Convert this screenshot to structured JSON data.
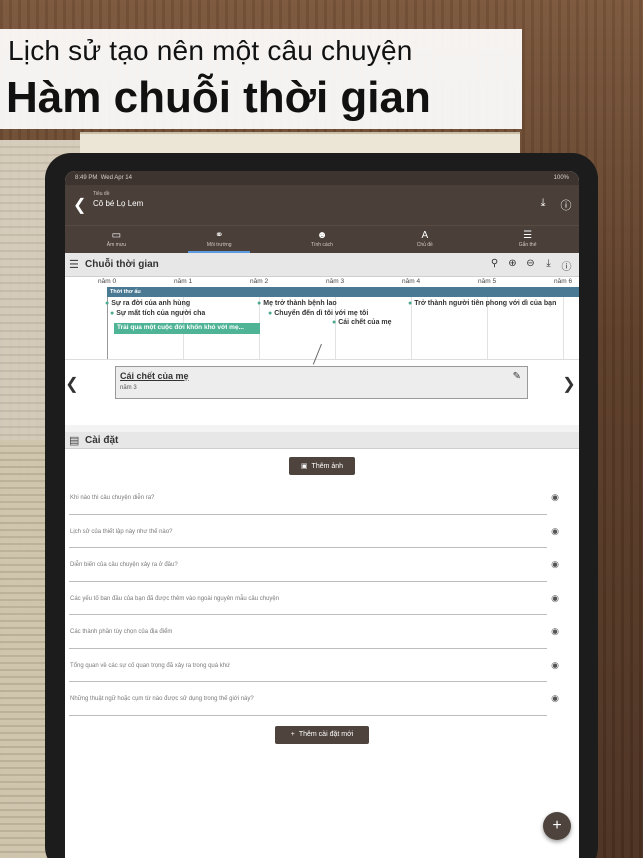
{
  "promo": {
    "subtitle": "Lịch sử tạo nên một câu chuyện",
    "title": "Hàm chuỗi thời gian"
  },
  "statusbar": {
    "time": "8:49 PM",
    "date": "Wed Apr 14",
    "battery": "100%"
  },
  "appbar": {
    "title_label": "Tiêu đề",
    "title_value": "Cô bé Lọ Lem",
    "icons": [
      "back-icon",
      "download-icon",
      "help-icon"
    ]
  },
  "tabs": [
    {
      "label": "Âm mưu",
      "icon": "chat-icon"
    },
    {
      "label": "Môi trường",
      "icon": "globe-icon",
      "active": true
    },
    {
      "label": "Tính cách",
      "icon": "people-icon"
    },
    {
      "label": "Chủ đề",
      "icon": "text-icon"
    },
    {
      "label": "Gắn thẻ",
      "icon": "tag-icon"
    }
  ],
  "timeline_section": {
    "title": "Chuỗi thời gian",
    "years": [
      "năm 0",
      "năm 1",
      "năm 2",
      "năm 3",
      "năm 4",
      "năm 5",
      "năm 6"
    ],
    "band_label": "Thời thơ ấu",
    "events": [
      "Sự ra đời của anh hùng",
      "Sự mất tích của người cha",
      "Mẹ trở thành bệnh lao",
      "Chuyển đến dì tôi với mẹ tôi",
      "Trở thành người tiên phong với dì của bạn",
      "Cái chết của mẹ"
    ],
    "span_event": "Trải qua một cuộc đời khốn khó với mẹ..."
  },
  "selected_event": {
    "title": "Cái chết của mẹ",
    "year": "năm 3"
  },
  "settings_section": {
    "title": "Cài đặt",
    "add_photo": "Thêm ảnh",
    "fields": [
      "Khi nào thì câu chuyện diễn ra?",
      "Lịch sử của thiết lập này như thế nào?",
      "Diễn biến của câu chuyện xảy ra ở đâu?",
      "Các yếu tố ban đầu của bạn đã được thêm vào ngoài nguyên mẫu câu chuyện",
      "Các thành phần tùy chọn của địa điểm",
      "Tổng quan về các sự cố quan trọng đã xảy ra trong quá khứ",
      "Những thuật ngữ hoặc cụm từ nào được sử dụng trong thế giới này?"
    ],
    "add_setting": "Thêm cài đặt mới"
  },
  "colors": {
    "appbar": "#4a3f39",
    "band": "#4a7a93",
    "event_pin": "#4aa88e",
    "span": "#4fb496",
    "tab_indicator": "#5c9be0"
  }
}
